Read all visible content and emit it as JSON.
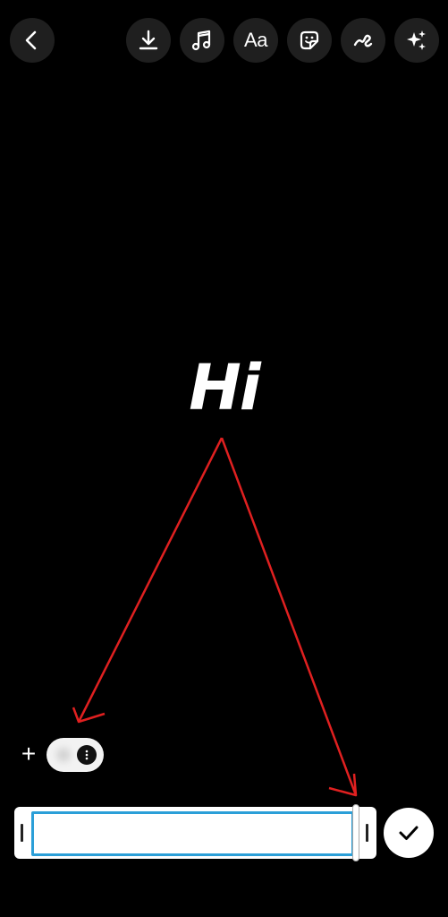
{
  "toolbar": {
    "buttons": [
      {
        "icon": "chevron-left-icon"
      },
      {
        "icon": "download-icon"
      },
      {
        "icon": "music-icon"
      },
      {
        "icon": "text-icon",
        "label": "Aa"
      },
      {
        "icon": "sticker-icon"
      },
      {
        "icon": "draw-icon"
      },
      {
        "icon": "effects-icon"
      }
    ]
  },
  "canvas": {
    "text": "Hi"
  },
  "annotation": {
    "arrow_color": "#e02020"
  },
  "timeline": {
    "add_label": "+",
    "selection_color": "#2b9fd8"
  },
  "actions": {
    "done_icon": "checkmark-icon"
  }
}
